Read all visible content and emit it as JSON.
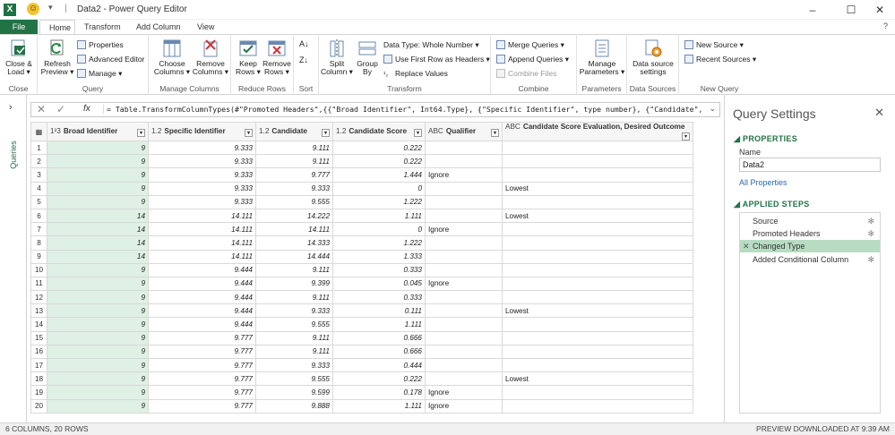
{
  "titlebar": {
    "title": "Data2 - Power Query Editor",
    "sep": "|",
    "qa": "▾",
    "smile": "☺",
    "app": "X"
  },
  "tabs": {
    "file": "File",
    "home": "Home",
    "transform": "Transform",
    "add_column": "Add Column",
    "view": "View"
  },
  "help": "?",
  "ribbon": {
    "close": {
      "label1": "Close &",
      "label2": "Load ▾",
      "group": "Close"
    },
    "query": {
      "refresh1": "Refresh",
      "refresh2": "Preview ▾",
      "properties": "Properties",
      "advanced": "Advanced Editor",
      "manage": "Manage ▾",
      "group": "Query"
    },
    "manage_columns": {
      "choose1": "Choose",
      "choose2": "Columns ▾",
      "remove1": "Remove",
      "remove2": "Columns ▾",
      "group": "Manage Columns"
    },
    "reduce_rows": {
      "keep1": "Keep",
      "keep2": "Rows ▾",
      "remove1": "Remove",
      "remove2": "Rows ▾",
      "group": "Reduce Rows"
    },
    "sort": {
      "group": "Sort"
    },
    "transform": {
      "split1": "Split",
      "split2": "Column ▾",
      "group1": "Group",
      "group2": "By",
      "datatype": "Data Type: Whole Number ▾",
      "firstrow": "Use First Row as Headers ▾",
      "replace": "Replace Values",
      "group": "Transform"
    },
    "combine": {
      "merge": "Merge Queries ▾",
      "append": "Append Queries ▾",
      "combine_files": "Combine Files",
      "group": "Combine"
    },
    "parameters": {
      "label1": "Manage",
      "label2": "Parameters ▾",
      "group": "Parameters"
    },
    "data_sources": {
      "label1": "Data source",
      "label2": "settings",
      "group": "Data Sources"
    },
    "new_query": {
      "new_source": "New Source ▾",
      "recent": "Recent Sources ▾",
      "group": "New Query"
    }
  },
  "left_rail": {
    "label": "Queries",
    "chevron": "›"
  },
  "formula": {
    "x": "✕",
    "check": "✓",
    "fx": "fx",
    "text": "= Table.TransformColumnTypes(#\"Promoted Headers\",{{\"Broad Identifier\", Int64.Type}, {\"Specific Identifier\", type number}, {\"Candidate\",",
    "expand": "⌄"
  },
  "grid": {
    "columns": [
      {
        "type": "1²3",
        "name": "Broad Identifier"
      },
      {
        "type": "1.2",
        "name": "Specific Identifier"
      },
      {
        "type": "1.2",
        "name": "Candidate"
      },
      {
        "type": "1.2",
        "name": "Candidate Score"
      },
      {
        "type": "ABC",
        "name": "Qualifier"
      },
      {
        "type": "ABC",
        "name": "Candidate Score Evaluation, Desired Outcome"
      }
    ],
    "rows": [
      [
        "1",
        "9",
        "9.333",
        "9.111",
        "0.222",
        "",
        ""
      ],
      [
        "2",
        "9",
        "9.333",
        "9.111",
        "0.222",
        "",
        ""
      ],
      [
        "3",
        "9",
        "9.333",
        "9.777",
        "1.444",
        "Ignore",
        ""
      ],
      [
        "4",
        "9",
        "9.333",
        "9.333",
        "0",
        "",
        "Lowest"
      ],
      [
        "5",
        "9",
        "9.333",
        "9.555",
        "1.222",
        "",
        ""
      ],
      [
        "6",
        "14",
        "14.111",
        "14.222",
        "1.111",
        "",
        "Lowest"
      ],
      [
        "7",
        "14",
        "14.111",
        "14.111",
        "0",
        "Ignore",
        ""
      ],
      [
        "8",
        "14",
        "14.111",
        "14.333",
        "1.222",
        "",
        ""
      ],
      [
        "9",
        "14",
        "14.111",
        "14.444",
        "1.333",
        "",
        ""
      ],
      [
        "10",
        "9",
        "9.444",
        "9.111",
        "0.333",
        "",
        ""
      ],
      [
        "11",
        "9",
        "9.444",
        "9.399",
        "0.045",
        "Ignore",
        ""
      ],
      [
        "12",
        "9",
        "9.444",
        "9.111",
        "0.333",
        "",
        ""
      ],
      [
        "13",
        "9",
        "9.444",
        "9.333",
        "0.111",
        "",
        "Lowest"
      ],
      [
        "14",
        "9",
        "9.444",
        "9.555",
        "1.111",
        "",
        ""
      ],
      [
        "15",
        "9",
        "9.777",
        "9.111",
        "0.666",
        "",
        ""
      ],
      [
        "16",
        "9",
        "9.777",
        "9.111",
        "0.666",
        "",
        ""
      ],
      [
        "17",
        "9",
        "9.777",
        "9.333",
        "0.444",
        "",
        ""
      ],
      [
        "18",
        "9",
        "9.777",
        "9.555",
        "0.222",
        "",
        "Lowest"
      ],
      [
        "19",
        "9",
        "9.777",
        "9.599",
        "0.178",
        "Ignore",
        ""
      ],
      [
        "20",
        "9",
        "9.777",
        "9.888",
        "1.111",
        "Ignore",
        ""
      ]
    ]
  },
  "query_settings": {
    "title": "Query Settings",
    "close": "✕",
    "properties_header": "◢ PROPERTIES",
    "name_label": "Name",
    "name_value": "Data2",
    "all_properties": "All Properties",
    "applied_steps_header": "◢ APPLIED STEPS",
    "steps": [
      "Source",
      "Promoted Headers",
      "Changed Type",
      "Added Conditional Column"
    ]
  },
  "status": {
    "left": "6 COLUMNS, 20 ROWS",
    "right": "PREVIEW DOWNLOADED AT 9:39 AM"
  }
}
